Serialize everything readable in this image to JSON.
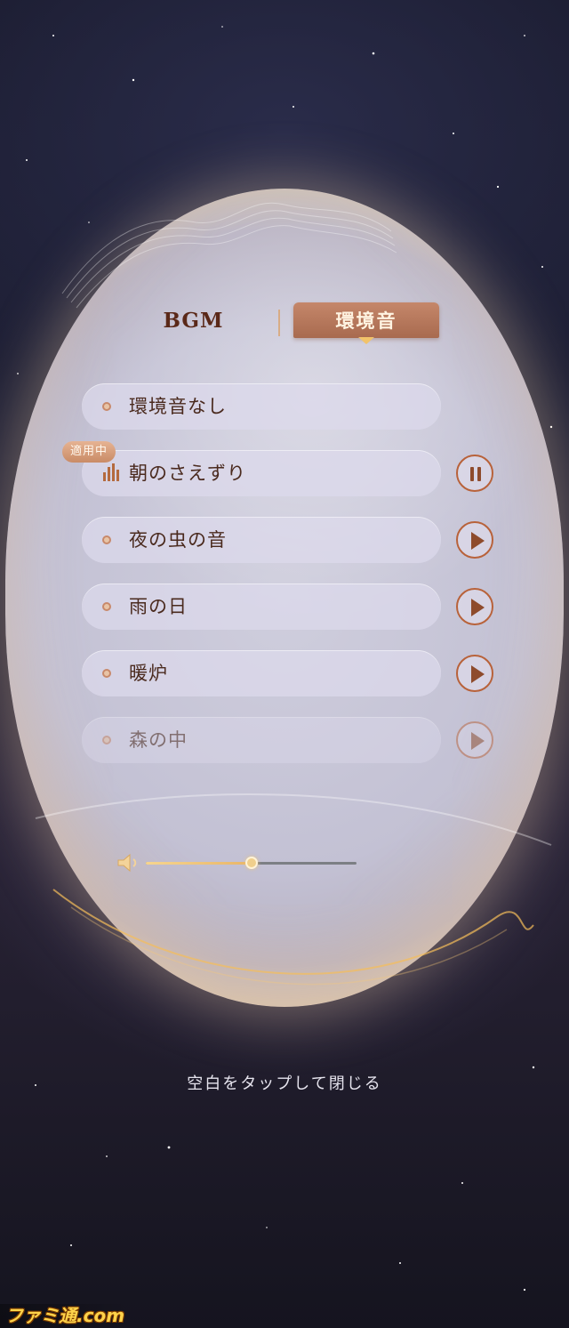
{
  "tabs": [
    {
      "label": "BGM",
      "active": false
    },
    {
      "label": "環境音",
      "active": true
    }
  ],
  "active_badge": "適用中",
  "sounds": [
    {
      "label": "環境音なし",
      "indicator": "dot",
      "control": "none"
    },
    {
      "label": "朝のさえずり",
      "indicator": "equalizer-bars",
      "control": "pause",
      "applied": true
    },
    {
      "label": "夜の虫の音",
      "indicator": "dot",
      "control": "play"
    },
    {
      "label": "雨の日",
      "indicator": "dot",
      "control": "play"
    },
    {
      "label": "暖炉",
      "indicator": "dot",
      "control": "play"
    },
    {
      "label": "森の中",
      "indicator": "dot",
      "control": "play",
      "faded": true
    }
  ],
  "volume": {
    "icon": "speaker-icon",
    "level": 0.5
  },
  "close_hint": "空白をタップして閉じる",
  "watermark_logo": "ファミ通.com",
  "colors": {
    "accent": "#b8623a",
    "tab_active_bg": "#b5785c",
    "slider_fill": "#f0cf8c"
  }
}
